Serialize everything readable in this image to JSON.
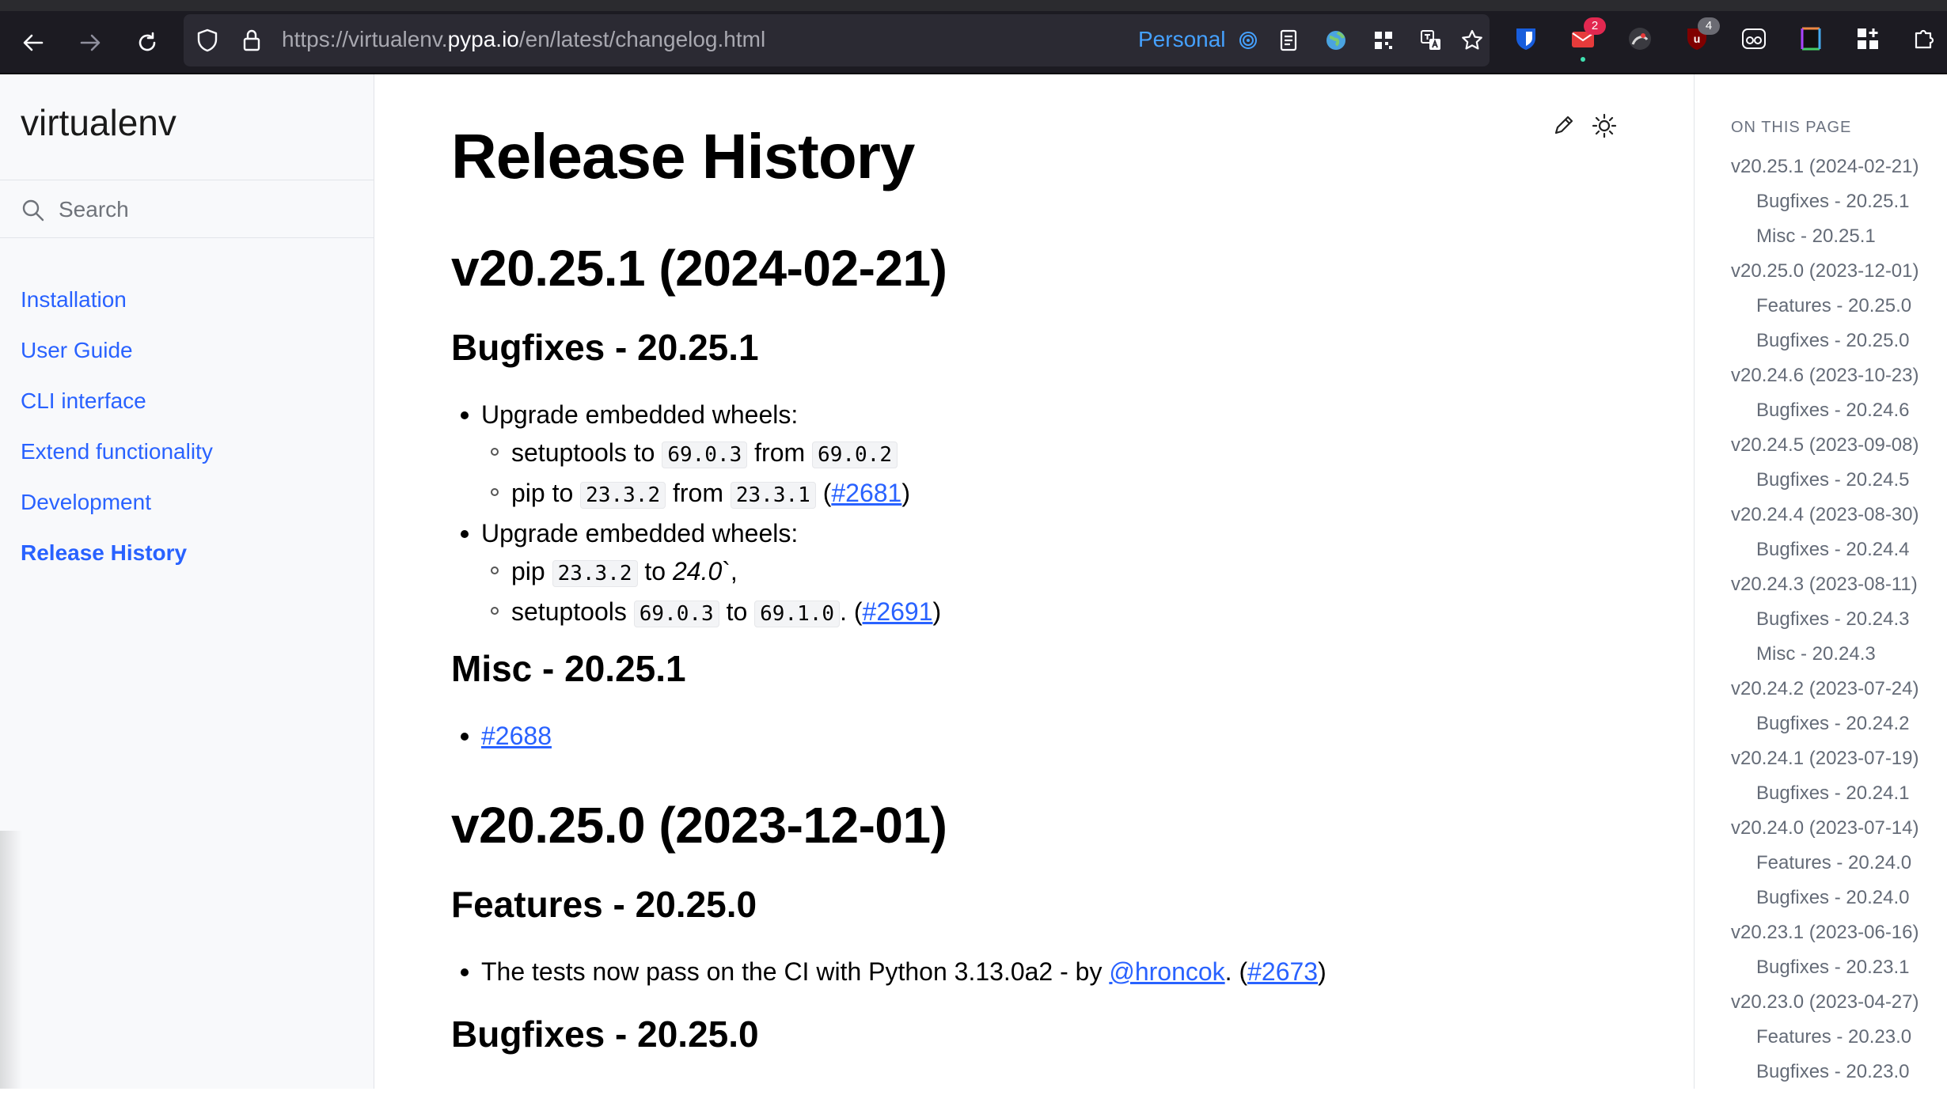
{
  "browser": {
    "url_prefix": "https://virtualenv.",
    "url_host": "pypa.io",
    "url_path": "/en/latest/changelog.html",
    "profile_label": "Personal",
    "badges": {
      "mail": "2",
      "ext_count": "4"
    },
    "accent": "#45a1ff"
  },
  "sidebar": {
    "brand": "virtualenv",
    "search_placeholder": "Search",
    "items": [
      {
        "label": "Installation",
        "active": false
      },
      {
        "label": "User Guide",
        "active": false
      },
      {
        "label": "CLI interface",
        "active": false
      },
      {
        "label": "Extend functionality",
        "active": false
      },
      {
        "label": "Development",
        "active": false
      },
      {
        "label": "Release History",
        "active": true
      }
    ],
    "link_color": "#2962ff"
  },
  "main": {
    "title": "Release History",
    "r1": {
      "heading": "v20.25.1 (2024-02-21)",
      "bugfixes_heading": "Bugfixes - 20.25.1",
      "b1": "Upgrade embedded wheels:",
      "b1_s1_a": "setuptools to ",
      "b1_s1_code1": "69.0.3",
      "b1_s1_b": " from ",
      "b1_s1_code2": "69.0.2",
      "b1_s2_a": "pip to ",
      "b1_s2_code1": "23.3.2",
      "b1_s2_b": " from ",
      "b1_s2_code2": "23.3.1",
      "b1_s2_c": " (",
      "b1_s2_link": "#2681",
      "b1_s2_d": ")",
      "b2": "Upgrade embedded wheels:",
      "b2_s1_a": "pip ",
      "b2_s1_code1": "23.3.2",
      "b2_s1_b": " to ",
      "b2_s1_it": "24.0",
      "b2_s1_c": "`,",
      "b2_s2_a": "setuptools ",
      "b2_s2_code1": "69.0.3",
      "b2_s2_b": " to ",
      "b2_s2_code2": "69.1.0",
      "b2_s2_c": ". (",
      "b2_s2_link": "#2691",
      "b2_s2_d": ")",
      "misc_heading": "Misc - 20.25.1",
      "misc_link": "#2688"
    },
    "r2": {
      "heading": "v20.25.0 (2023-12-01)",
      "features_heading": "Features - 20.25.0",
      "f1_a": "The tests now pass on the CI with Python 3.13.0a2 - by ",
      "f1_link1": "@hroncok",
      "f1_b": ". (",
      "f1_link2": "#2673",
      "f1_c": ")",
      "bugfixes_heading": "Bugfixes - 20.25.0"
    }
  },
  "toc": {
    "title": "ON THIS PAGE",
    "items": [
      {
        "label": "v20.25.1 (2024-02-21)",
        "level": 1
      },
      {
        "label": "Bugfixes - 20.25.1",
        "level": 2
      },
      {
        "label": "Misc - 20.25.1",
        "level": 2
      },
      {
        "label": "v20.25.0 (2023-12-01)",
        "level": 1
      },
      {
        "label": "Features - 20.25.0",
        "level": 2
      },
      {
        "label": "Bugfixes - 20.25.0",
        "level": 2
      },
      {
        "label": "v20.24.6 (2023-10-23)",
        "level": 1
      },
      {
        "label": "Bugfixes - 20.24.6",
        "level": 2
      },
      {
        "label": "v20.24.5 (2023-09-08)",
        "level": 1
      },
      {
        "label": "Bugfixes - 20.24.5",
        "level": 2
      },
      {
        "label": "v20.24.4 (2023-08-30)",
        "level": 1
      },
      {
        "label": "Bugfixes - 20.24.4",
        "level": 2
      },
      {
        "label": "v20.24.3 (2023-08-11)",
        "level": 1
      },
      {
        "label": "Bugfixes - 20.24.3",
        "level": 2
      },
      {
        "label": "Misc - 20.24.3",
        "level": 2
      },
      {
        "label": "v20.24.2 (2023-07-24)",
        "level": 1
      },
      {
        "label": "Bugfixes - 20.24.2",
        "level": 2
      },
      {
        "label": "v20.24.1 (2023-07-19)",
        "level": 1
      },
      {
        "label": "Bugfixes - 20.24.1",
        "level": 2
      },
      {
        "label": "v20.24.0 (2023-07-14)",
        "level": 1
      },
      {
        "label": "Features - 20.24.0",
        "level": 2
      },
      {
        "label": "Bugfixes - 20.24.0",
        "level": 2
      },
      {
        "label": "v20.23.1 (2023-06-16)",
        "level": 1
      },
      {
        "label": "Bugfixes - 20.23.1",
        "level": 2
      },
      {
        "label": "v20.23.0 (2023-04-27)",
        "level": 1
      },
      {
        "label": "Features - 20.23.0",
        "level": 2
      },
      {
        "label": "Bugfixes - 20.23.0",
        "level": 2
      }
    ]
  }
}
